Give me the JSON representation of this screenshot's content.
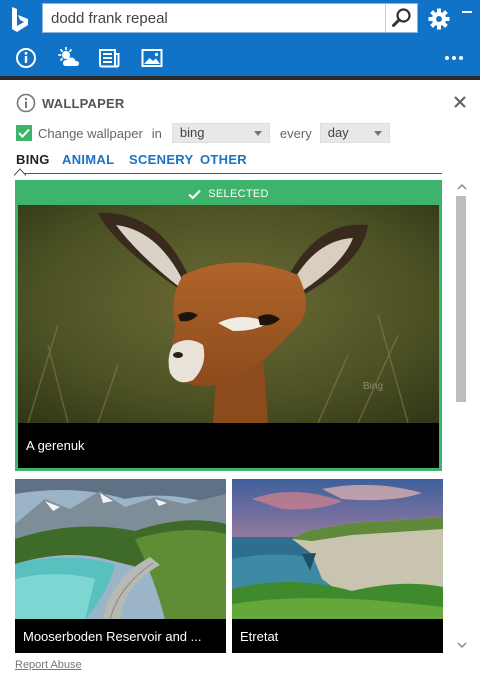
{
  "search": {
    "value": "dodd frank repeal"
  },
  "toolbar": {
    "icons": [
      "info-icon",
      "weather-icon",
      "news-icon",
      "wallpaper-icon",
      "more-icon"
    ]
  },
  "panel": {
    "title": "WALLPAPER",
    "change_label": "Change wallpaper",
    "in_label": "in",
    "source_value": "bing",
    "every_label": "every",
    "interval_value": "day"
  },
  "tabs": [
    "BING",
    "ANIMAL",
    "SCENERY",
    "OTHER"
  ],
  "selected_tile": {
    "badge": "SELECTED",
    "caption": "A gerenuk",
    "watermark": "Bing"
  },
  "tiles": [
    {
      "caption": "Mooserboden Reservoir and ..."
    },
    {
      "caption": "Etretat"
    }
  ],
  "footer": {
    "report_abuse": "Report Abuse"
  },
  "colors": {
    "brand_blue": "#1073c8",
    "selected_green": "#3db36b",
    "toolbar_dark": "#2b2b2b"
  }
}
